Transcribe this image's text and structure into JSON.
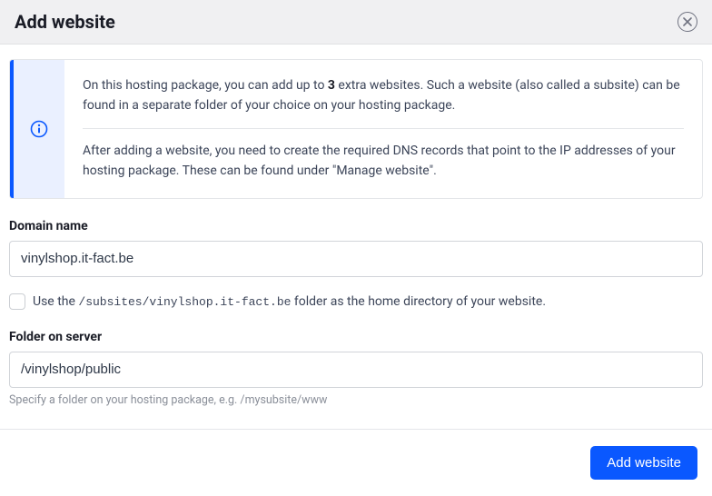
{
  "header": {
    "title": "Add website"
  },
  "info": {
    "para1_prefix": "On this hosting package, you can add up to ",
    "max_extra": "3",
    "para1_suffix": " extra websites. Such a website (also called a subsite) can be found in a separate folder of your choice on your hosting package.",
    "para2": "After adding a website, you need to create the required DNS records that point to the IP addresses of your hosting package. These can be found under \"Manage website\"."
  },
  "domain": {
    "label": "Domain name",
    "value": "vinylshop.it-fact.be"
  },
  "checkbox": {
    "prefix": "Use the ",
    "path": "/subsites/vinylshop.it-fact.be",
    "suffix": " folder as the home directory of your website."
  },
  "folder": {
    "label": "Folder on server",
    "value": "/vinylshop/public",
    "helper": "Specify a folder on your hosting package, e.g. /mysubsite/www"
  },
  "buttons": {
    "submit": "Add website"
  },
  "colors": {
    "accent": "#0a58ff"
  }
}
